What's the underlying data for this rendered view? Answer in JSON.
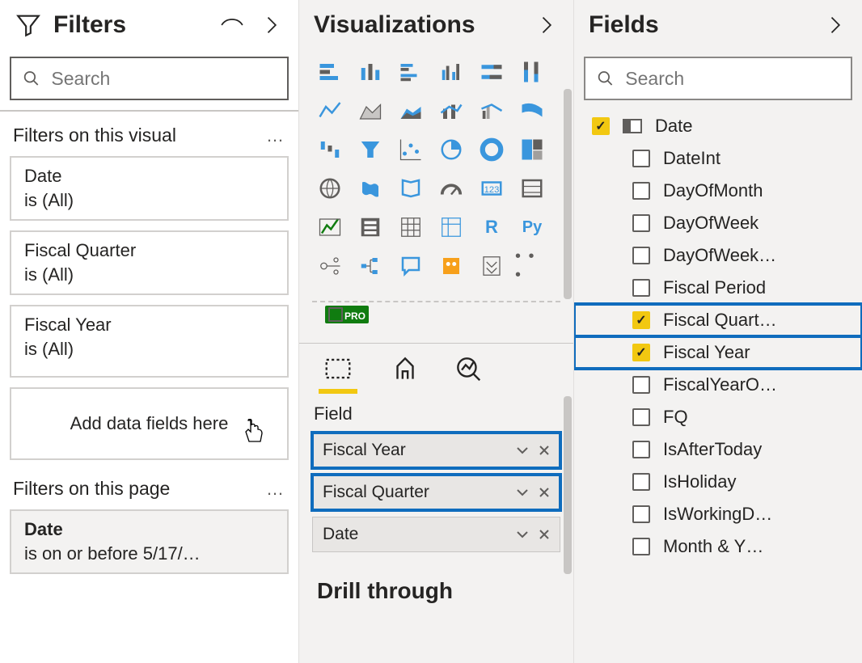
{
  "filters": {
    "title": "Filters",
    "search_placeholder": "Search",
    "section_visual": "Filters on this visual",
    "cards": [
      {
        "name": "Date",
        "value": "is (All)"
      },
      {
        "name": "Fiscal Quarter",
        "value": "is (All)"
      },
      {
        "name": "Fiscal Year",
        "value": "is (All)"
      }
    ],
    "drop_hint": "Add data fields here",
    "section_page": "Filters on this page",
    "page_card": {
      "name": "Date",
      "value": "is on or before 5/17/…"
    }
  },
  "visualizations": {
    "title": "Visualizations",
    "well_label": "Field",
    "wells": [
      {
        "label": "Fiscal Year",
        "highlighted": true
      },
      {
        "label": "Fiscal Quarter",
        "highlighted": true
      },
      {
        "label": "Date",
        "highlighted": false
      }
    ],
    "drill_title": "Drill through"
  },
  "fields": {
    "title": "Fields",
    "search_placeholder": "Search",
    "table": "Date",
    "items": [
      {
        "label": "DateInt",
        "checked": false,
        "highlighted": false
      },
      {
        "label": "DayOfMonth",
        "checked": false,
        "highlighted": false
      },
      {
        "label": "DayOfWeek",
        "checked": false,
        "highlighted": false
      },
      {
        "label": "DayOfWeek…",
        "checked": false,
        "highlighted": false
      },
      {
        "label": "Fiscal Period",
        "checked": false,
        "highlighted": false
      },
      {
        "label": "Fiscal Quart…",
        "checked": true,
        "highlighted": true
      },
      {
        "label": "Fiscal Year",
        "checked": true,
        "highlighted": true
      },
      {
        "label": "FiscalYearO…",
        "checked": false,
        "highlighted": false
      },
      {
        "label": "FQ",
        "checked": false,
        "highlighted": false
      },
      {
        "label": "IsAfterToday",
        "checked": false,
        "highlighted": false
      },
      {
        "label": "IsHoliday",
        "checked": false,
        "highlighted": false
      },
      {
        "label": "IsWorkingD…",
        "checked": false,
        "highlighted": false
      },
      {
        "label": "Month & Y…",
        "checked": false,
        "highlighted": false
      }
    ]
  }
}
